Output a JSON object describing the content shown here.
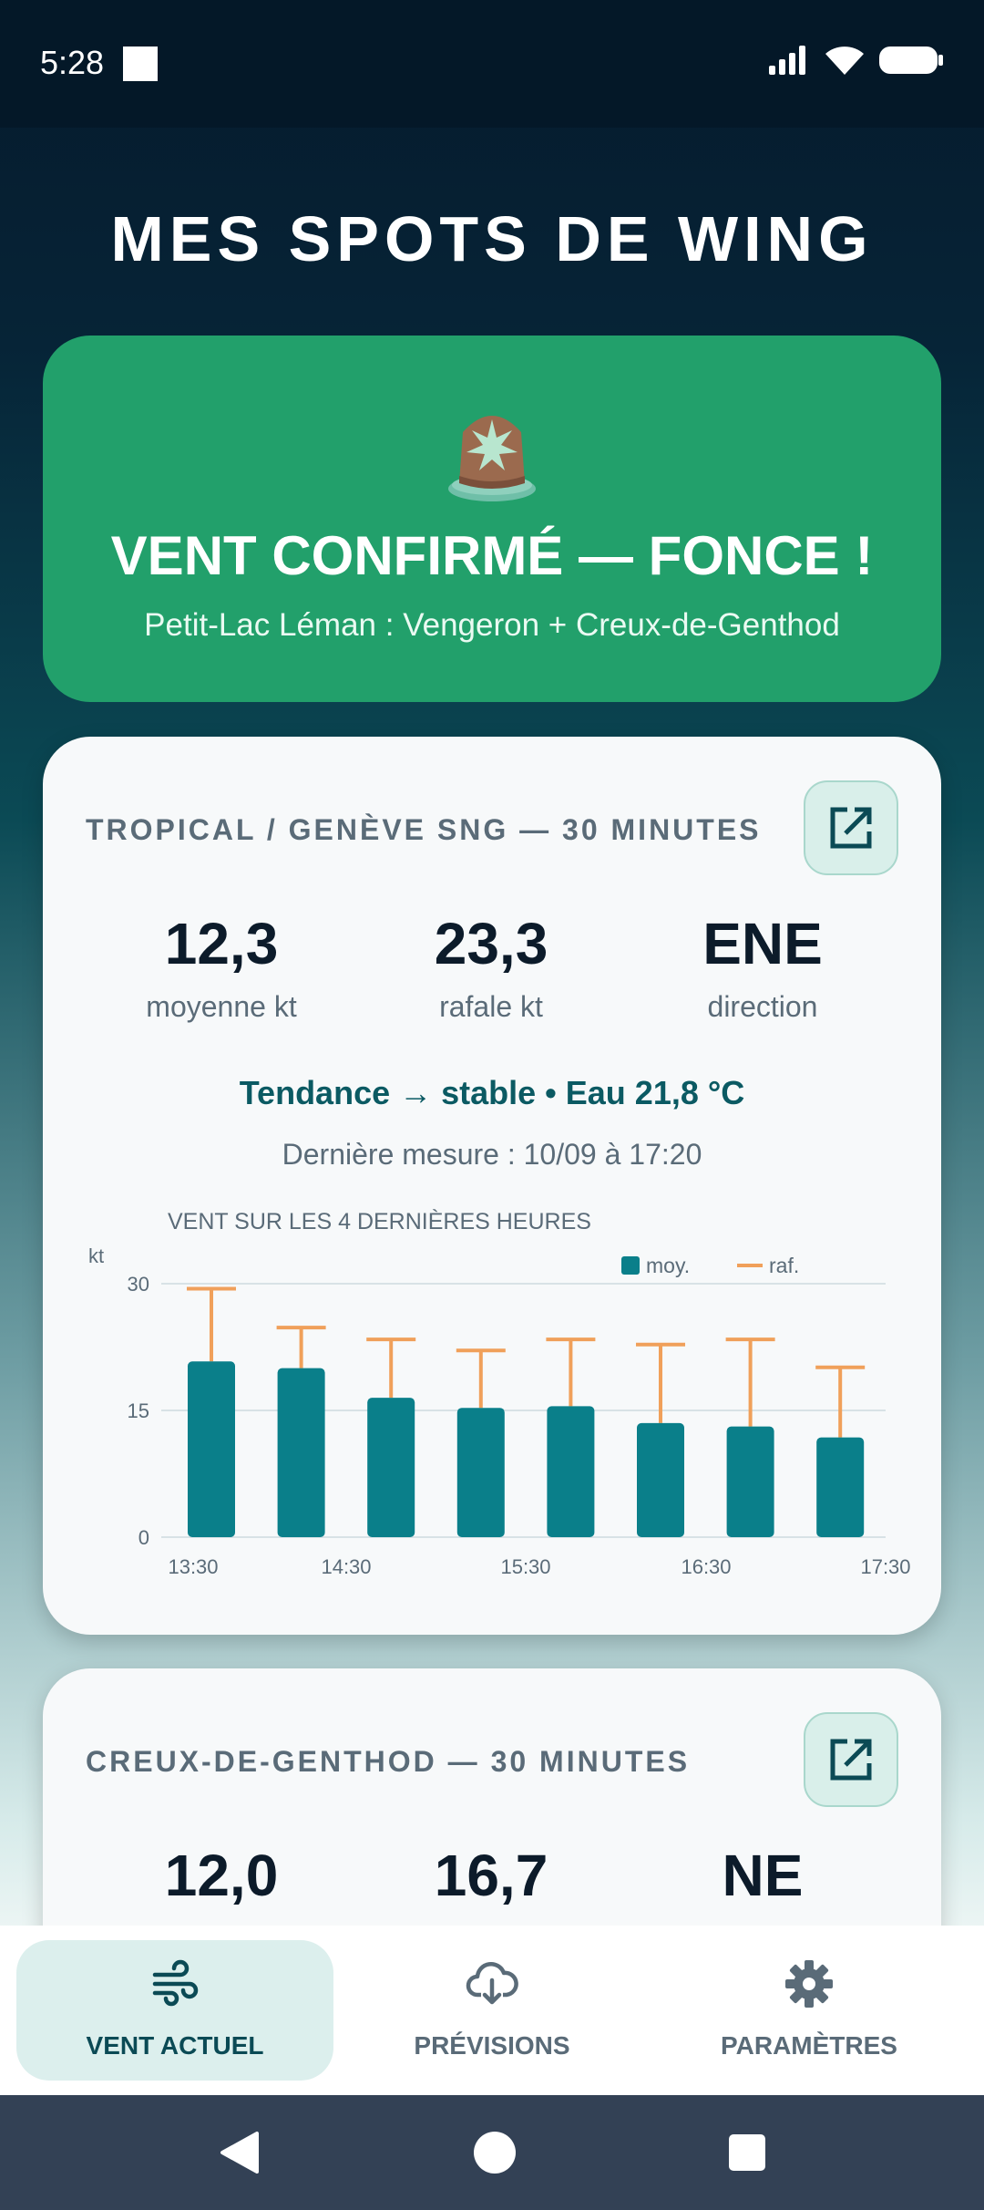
{
  "status": {
    "time": "5:28"
  },
  "header": {
    "title": "MES SPOTS DE WING"
  },
  "alert": {
    "title": "VENT CONFIRMÉ — FONCE !",
    "subtitle": "Petit-Lac Léman : Vengeron + Creux-de-Genthod",
    "icon": "siren-icon",
    "color": "#22a06b"
  },
  "stations": [
    {
      "title": "TROPICAL / GENÈVE SNG — 30 MINUTES",
      "mean": "12,3",
      "mean_label": "moyenne kt",
      "gust": "23,3",
      "gust_label": "rafale kt",
      "direction": "ENE",
      "direction_label": "direction",
      "trend": "Tendance → stable  •  Eau 21,8 °C",
      "last": "Dernière mesure : 10/09 à 17:20"
    },
    {
      "title": "CREUX-DE-GENTHOD — 30 MINUTES",
      "mean": "12,0",
      "gust": "16,7",
      "direction": "NE"
    }
  ],
  "chart_data": {
    "type": "bar",
    "title": "VENT SUR LES 4 DERNIÈRES HEURES",
    "ylabel": "kt",
    "ylim": [
      0,
      30
    ],
    "yticks": [
      "0",
      "15",
      "30"
    ],
    "xtick_labels": [
      "13:30",
      "14:30",
      "15:30",
      "16:30",
      "17:30"
    ],
    "categories": [
      "13:30",
      "14:00",
      "14:30",
      "15:00",
      "15:30",
      "16:00",
      "16:30",
      "17:00"
    ],
    "series": [
      {
        "name": "moy.",
        "values": [
          20.8,
          20.0,
          16.5,
          15.3,
          15.5,
          13.5,
          13.1,
          11.8
        ],
        "color": "#0a7f8a"
      },
      {
        "name": "raf.",
        "values": [
          29.4,
          24.8,
          23.4,
          22.1,
          23.4,
          22.8,
          23.4,
          20.1
        ],
        "color": "#f0a05a"
      }
    ],
    "legend": "top-right",
    "grid": true
  },
  "nav": {
    "items": [
      {
        "label": "VENT ACTUEL",
        "icon": "wind-icon",
        "active": true
      },
      {
        "label": "PRÉVISIONS",
        "icon": "cloud-download-icon",
        "active": false
      },
      {
        "label": "PARAMÈTRES",
        "icon": "gear-icon",
        "active": false
      }
    ]
  }
}
